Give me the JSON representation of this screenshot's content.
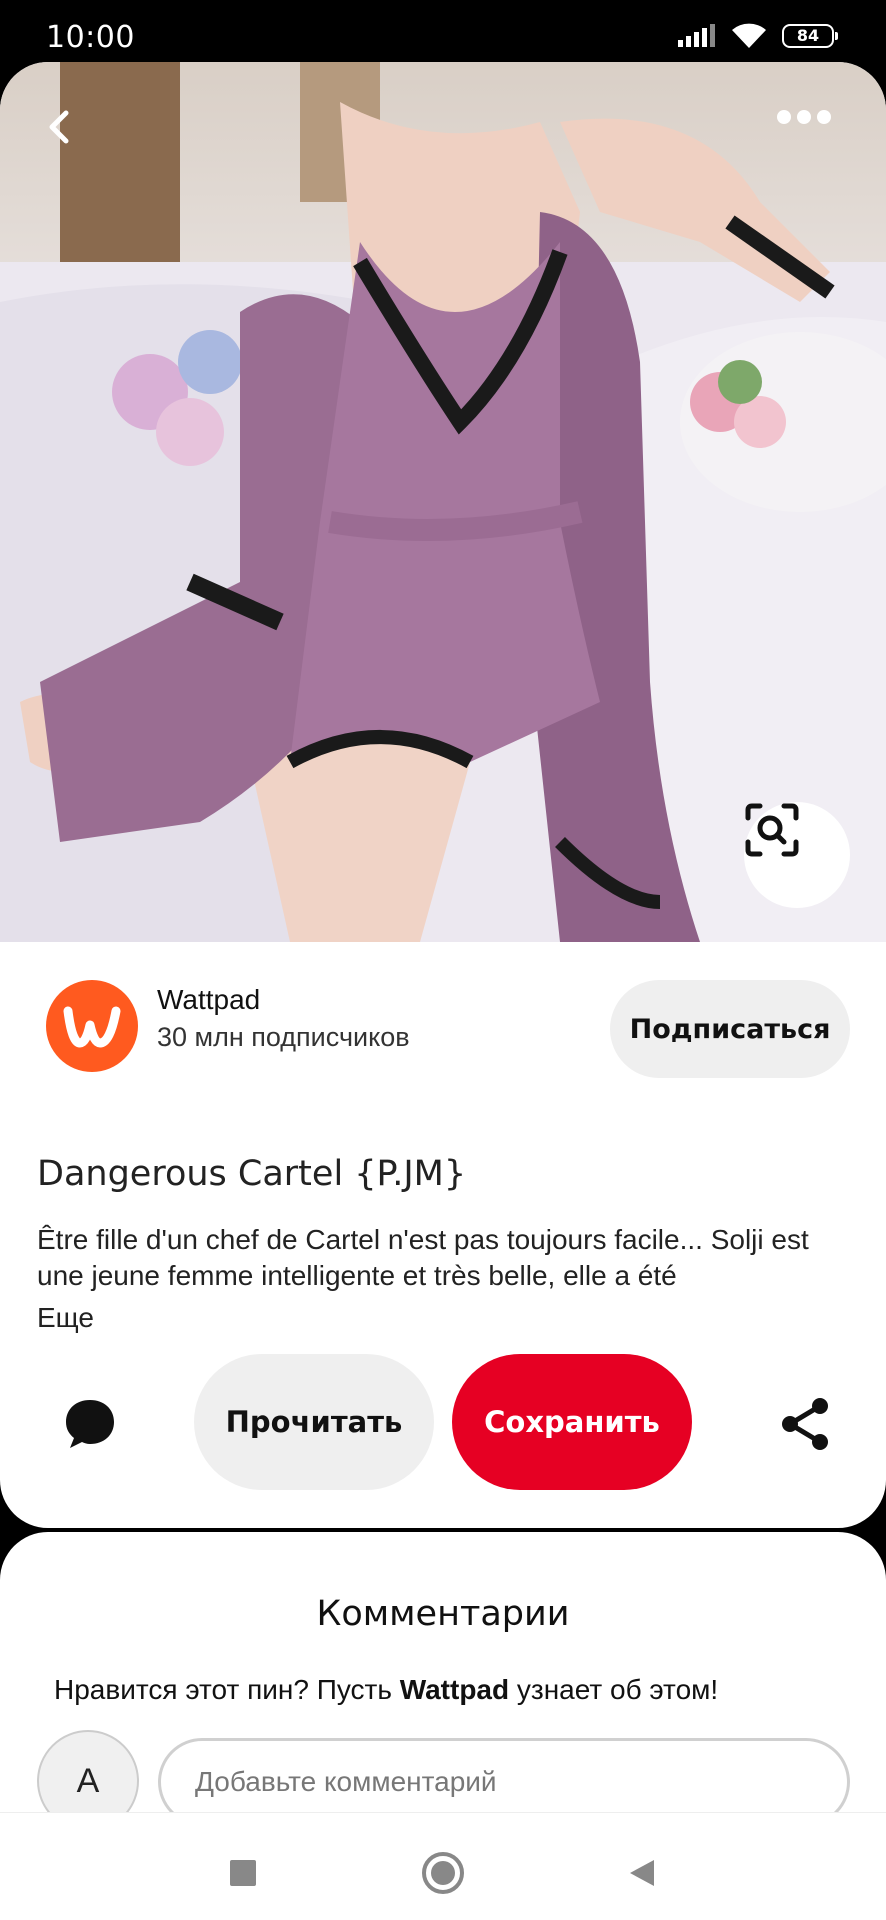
{
  "status_bar": {
    "time": "10:00",
    "battery": "84"
  },
  "creator": {
    "name": "Wattpad",
    "followers": "30 млн подписчиков",
    "follow_label": "Подписаться"
  },
  "pin": {
    "title": "Dangerous Cartel {P.JM}",
    "description": "Être fille d'un chef de Cartel n'est pas toujours facile... Solji est une jeune femme intelligente et très belle, elle a été",
    "more_label": "Еще"
  },
  "actions": {
    "read_label": "Прочитать",
    "save_label": "Сохранить"
  },
  "comments": {
    "title": "Комментарии",
    "prompt_before": "Нравится этот пин? Пусть ",
    "prompt_brand": "Wattpad",
    "prompt_after": " узнает об этом!",
    "avatar_letter": "A",
    "input_placeholder": "Добавьте комментарий"
  },
  "colors": {
    "save": "#e60023",
    "brand": "#ff5a1f",
    "dress": "#9a6d92"
  },
  "icons": [
    "back-icon",
    "more-icon",
    "lens-icon",
    "comment-icon",
    "share-icon",
    "nav-recents-icon",
    "nav-home-icon",
    "nav-back-icon",
    "wifi-icon",
    "signal-icon"
  ]
}
